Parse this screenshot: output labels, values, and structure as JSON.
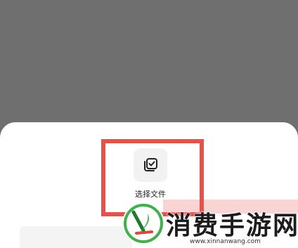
{
  "screen": {
    "overlay_color": "#6f6f6f",
    "sheet_color": "#ffffff"
  },
  "sheet": {
    "options": [
      {
        "label": "选择文件",
        "icon": "select-file-icon"
      }
    ]
  },
  "annotation": {
    "highlight_color": "#e2534a"
  },
  "watermark": {
    "name": "消费手游网",
    "url": "www.xinnanwang.com",
    "logo_color": "#3fb14a"
  }
}
